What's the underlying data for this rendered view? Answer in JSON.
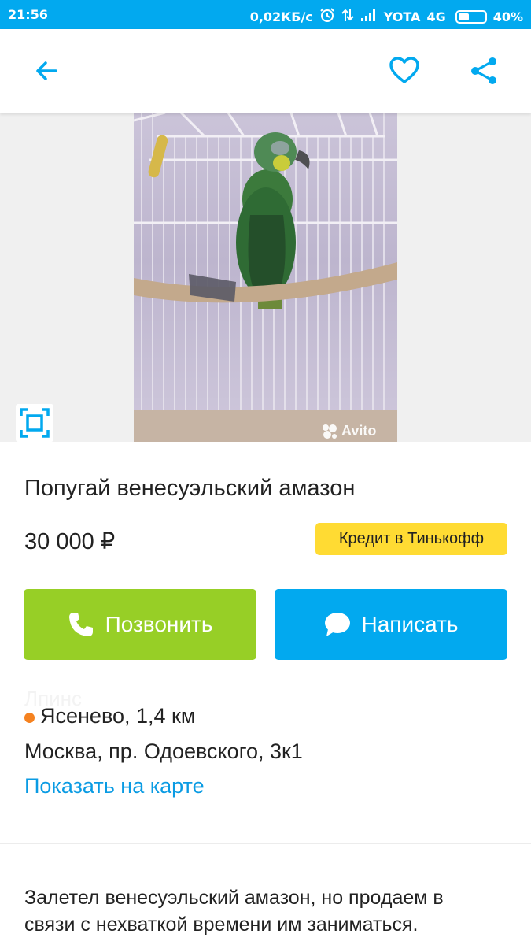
{
  "status_bar": {
    "time": "21:56",
    "speed": "0,02КБ/с",
    "carrier": "YOTA",
    "network": "4G",
    "battery": "40%",
    "battery_level": 0.4
  },
  "toolbar": {
    "back_icon": "arrow-left-icon",
    "favorite_icon": "heart-outline-icon",
    "share_icon": "share-icon"
  },
  "photo": {
    "watermark": "Avito",
    "fullscreen_icon": "fullscreen-icon"
  },
  "listing": {
    "title": "Попугай венесуэльский амазон",
    "price": "30 000 ₽",
    "credit_label": "Кредит в Тинькофф"
  },
  "actions": {
    "call_label": "Позвонить",
    "write_label": "Написать"
  },
  "location": {
    "ghost_text": "Лпинс",
    "metro": "Ясенево, 1,4 км",
    "address": "Москва, пр. Одоевского, 3к1",
    "map_link": "Показать на карте"
  },
  "description": "Залетел венесуэльский амазон, но продаем в связи с нехваткой времени им заниматься.",
  "colors": {
    "accent": "#02a9ef",
    "call_button": "#97cf26",
    "credit_badge": "#ffdb33",
    "metro_dot": "#f58220",
    "link": "#0a9be3"
  }
}
